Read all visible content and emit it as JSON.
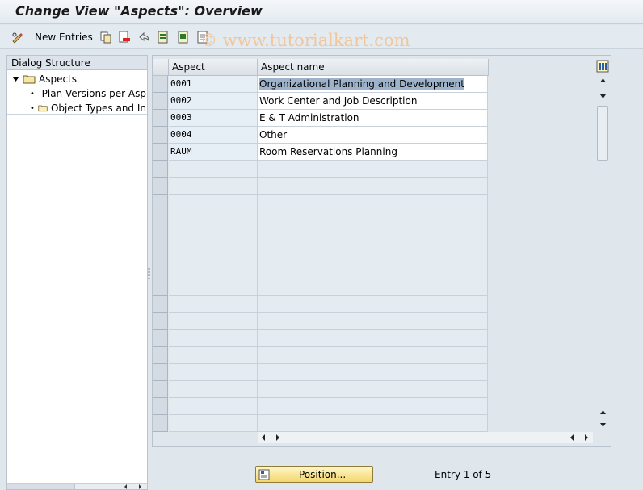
{
  "title": "Change View \"Aspects\": Overview",
  "toolbar": {
    "new_entries_label": "New Entries"
  },
  "watermark": "© www.tutorialkart.com",
  "dialog_structure": {
    "header": "Dialog Structure",
    "items": [
      {
        "label": "Aspects",
        "level": 0,
        "expanded": true,
        "selected": true
      },
      {
        "label": "Plan Versions per Asp",
        "level": 1
      },
      {
        "label": "Object Types and In",
        "level": 1
      }
    ]
  },
  "table": {
    "columns": [
      "Aspect",
      "Aspect name"
    ],
    "rows": [
      {
        "aspect": "0001",
        "name": "Organizational Planning and Development",
        "highlighted": true
      },
      {
        "aspect": "0002",
        "name": "Work Center and Job Description"
      },
      {
        "aspect": "0003",
        "name": "E & T Administration"
      },
      {
        "aspect": "0004",
        "name": "Other"
      },
      {
        "aspect": "RAUM",
        "name": "Room Reservations Planning"
      }
    ],
    "empty_rows": 16
  },
  "position_button_label": "Position...",
  "entry_status": "Entry 1 of 5",
  "colors": {
    "key_cell": "#e6eef6",
    "highlight": "#9db3cc",
    "button": "#f4d66c"
  }
}
